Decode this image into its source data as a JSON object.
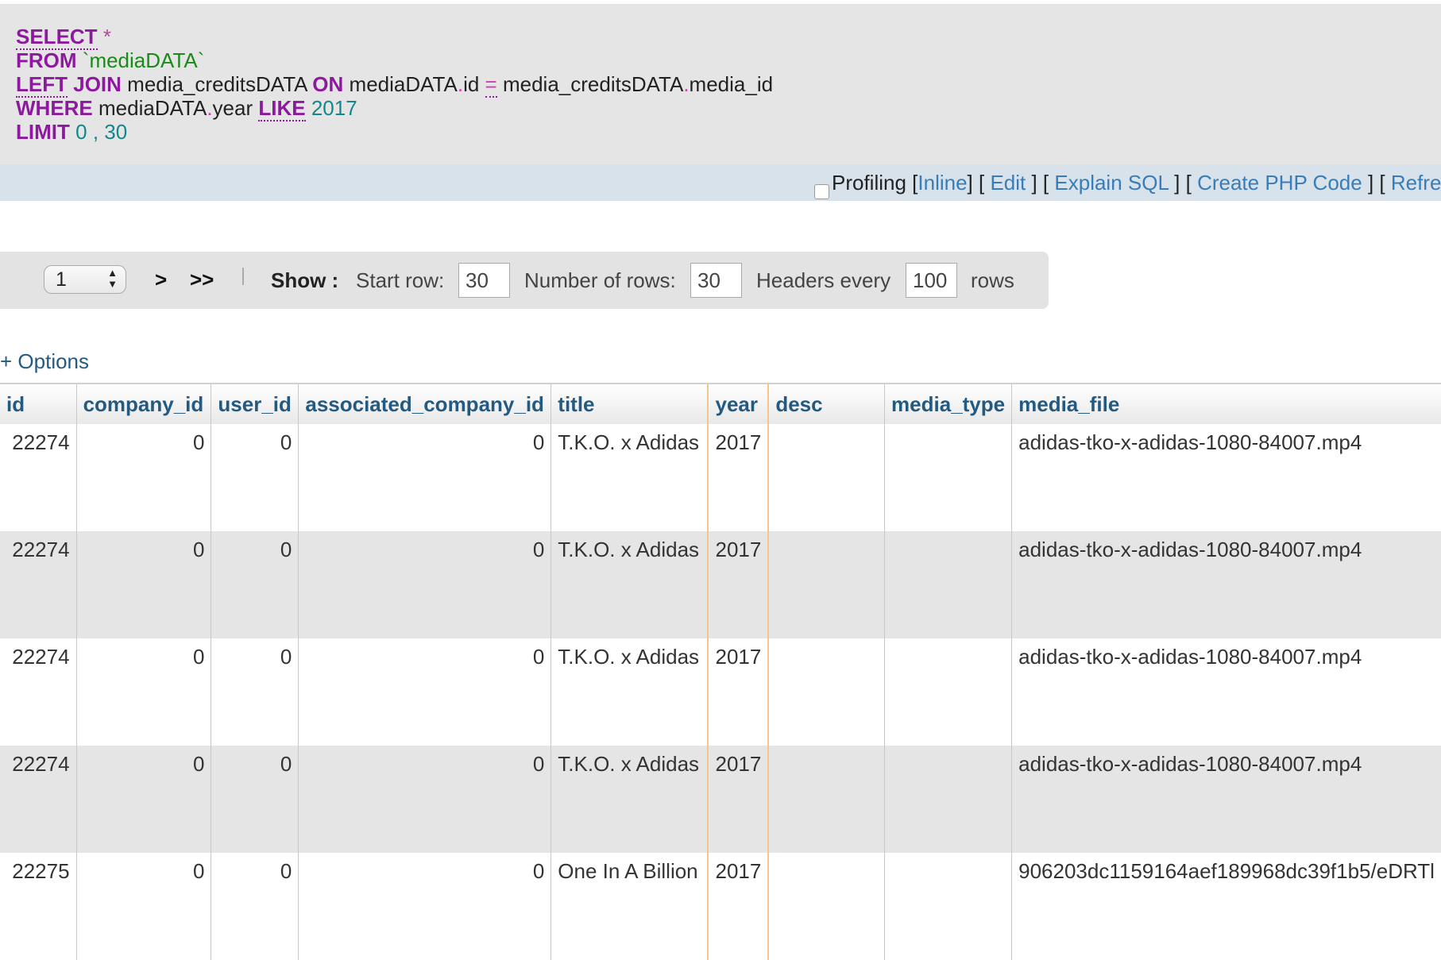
{
  "sql": {
    "select_kw": "SELECT",
    "star": "*",
    "from_kw": "FROM",
    "table": "`mediaDATA`",
    "left_kw": "LEFT",
    "join_kw": "JOIN",
    "join_table": "media_creditsDATA",
    "on_kw": "ON",
    "left_ident": "mediaDATA",
    "dot": ".",
    "left_field": "id",
    "eq": "=",
    "right_ident": "media_creditsDATA",
    "right_field": "media_id",
    "where_kw": "WHERE",
    "where_ident": "mediaDATA",
    "where_field": "year",
    "like_kw": "LIKE",
    "like_val": "2017",
    "limit_kw": "LIMIT",
    "limit_start": "0",
    "comma": ",",
    "limit_count": "30"
  },
  "actions": {
    "profiling": "Profiling",
    "inline": "Inline",
    "edit": "Edit",
    "explain": "Explain SQL",
    "create_php": "Create PHP Code",
    "refresh": "Refre"
  },
  "nav": {
    "page_value": "1",
    "next": ">",
    "last": ">>",
    "show_label": "Show :",
    "start_row_label": "Start row:",
    "start_row_value": "30",
    "num_rows_label": "Number of rows:",
    "num_rows_value": "30",
    "headers_every_label": "Headers every",
    "headers_every_value": "100",
    "rows_label": "rows"
  },
  "options_label": "+ Options",
  "table": {
    "columns": [
      "id",
      "company_id",
      "user_id",
      "associated_company_id",
      "title",
      "year",
      "desc",
      "media_type",
      "media_file"
    ],
    "rows": [
      [
        "22274",
        "0",
        "0",
        "0",
        "T.K.O. x Adidas",
        "2017",
        "",
        "",
        "adidas-tko-x-adidas-1080-84007.mp4"
      ],
      [
        "22274",
        "0",
        "0",
        "0",
        "T.K.O. x Adidas",
        "2017",
        "",
        "",
        "adidas-tko-x-adidas-1080-84007.mp4"
      ],
      [
        "22274",
        "0",
        "0",
        "0",
        "T.K.O. x Adidas",
        "2017",
        "",
        "",
        "adidas-tko-x-adidas-1080-84007.mp4"
      ],
      [
        "22274",
        "0",
        "0",
        "0",
        "T.K.O. x Adidas",
        "2017",
        "",
        "",
        "adidas-tko-x-adidas-1080-84007.mp4"
      ],
      [
        "22275",
        "0",
        "0",
        "0",
        "One In A Billion",
        "2017",
        "",
        "",
        "906203dc1159164aef189968dc39f1b5/eDRTl"
      ]
    ]
  }
}
